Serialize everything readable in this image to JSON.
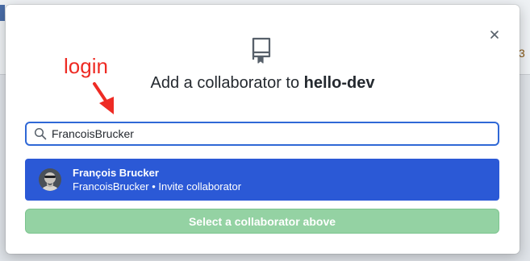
{
  "background": {
    "edge_right_text": "3"
  },
  "dialog": {
    "title_prefix": "Add a collaborator to ",
    "title_repo": "hello-dev",
    "repo_icon": "repo-icon",
    "close_icon": "close-icon"
  },
  "annotation": {
    "label": "login",
    "color": "#ee2b24"
  },
  "search": {
    "value": "FrancoisBrucker",
    "icon": "search-icon"
  },
  "suggestion": {
    "name": "François Brucker",
    "login": "FrancoisBrucker",
    "separator": " • ",
    "action": "Invite collaborator",
    "highlight_color": "#2b59d6"
  },
  "submit": {
    "label": "Select a collaborator above",
    "disabled": true,
    "color": "#94d2a3"
  }
}
